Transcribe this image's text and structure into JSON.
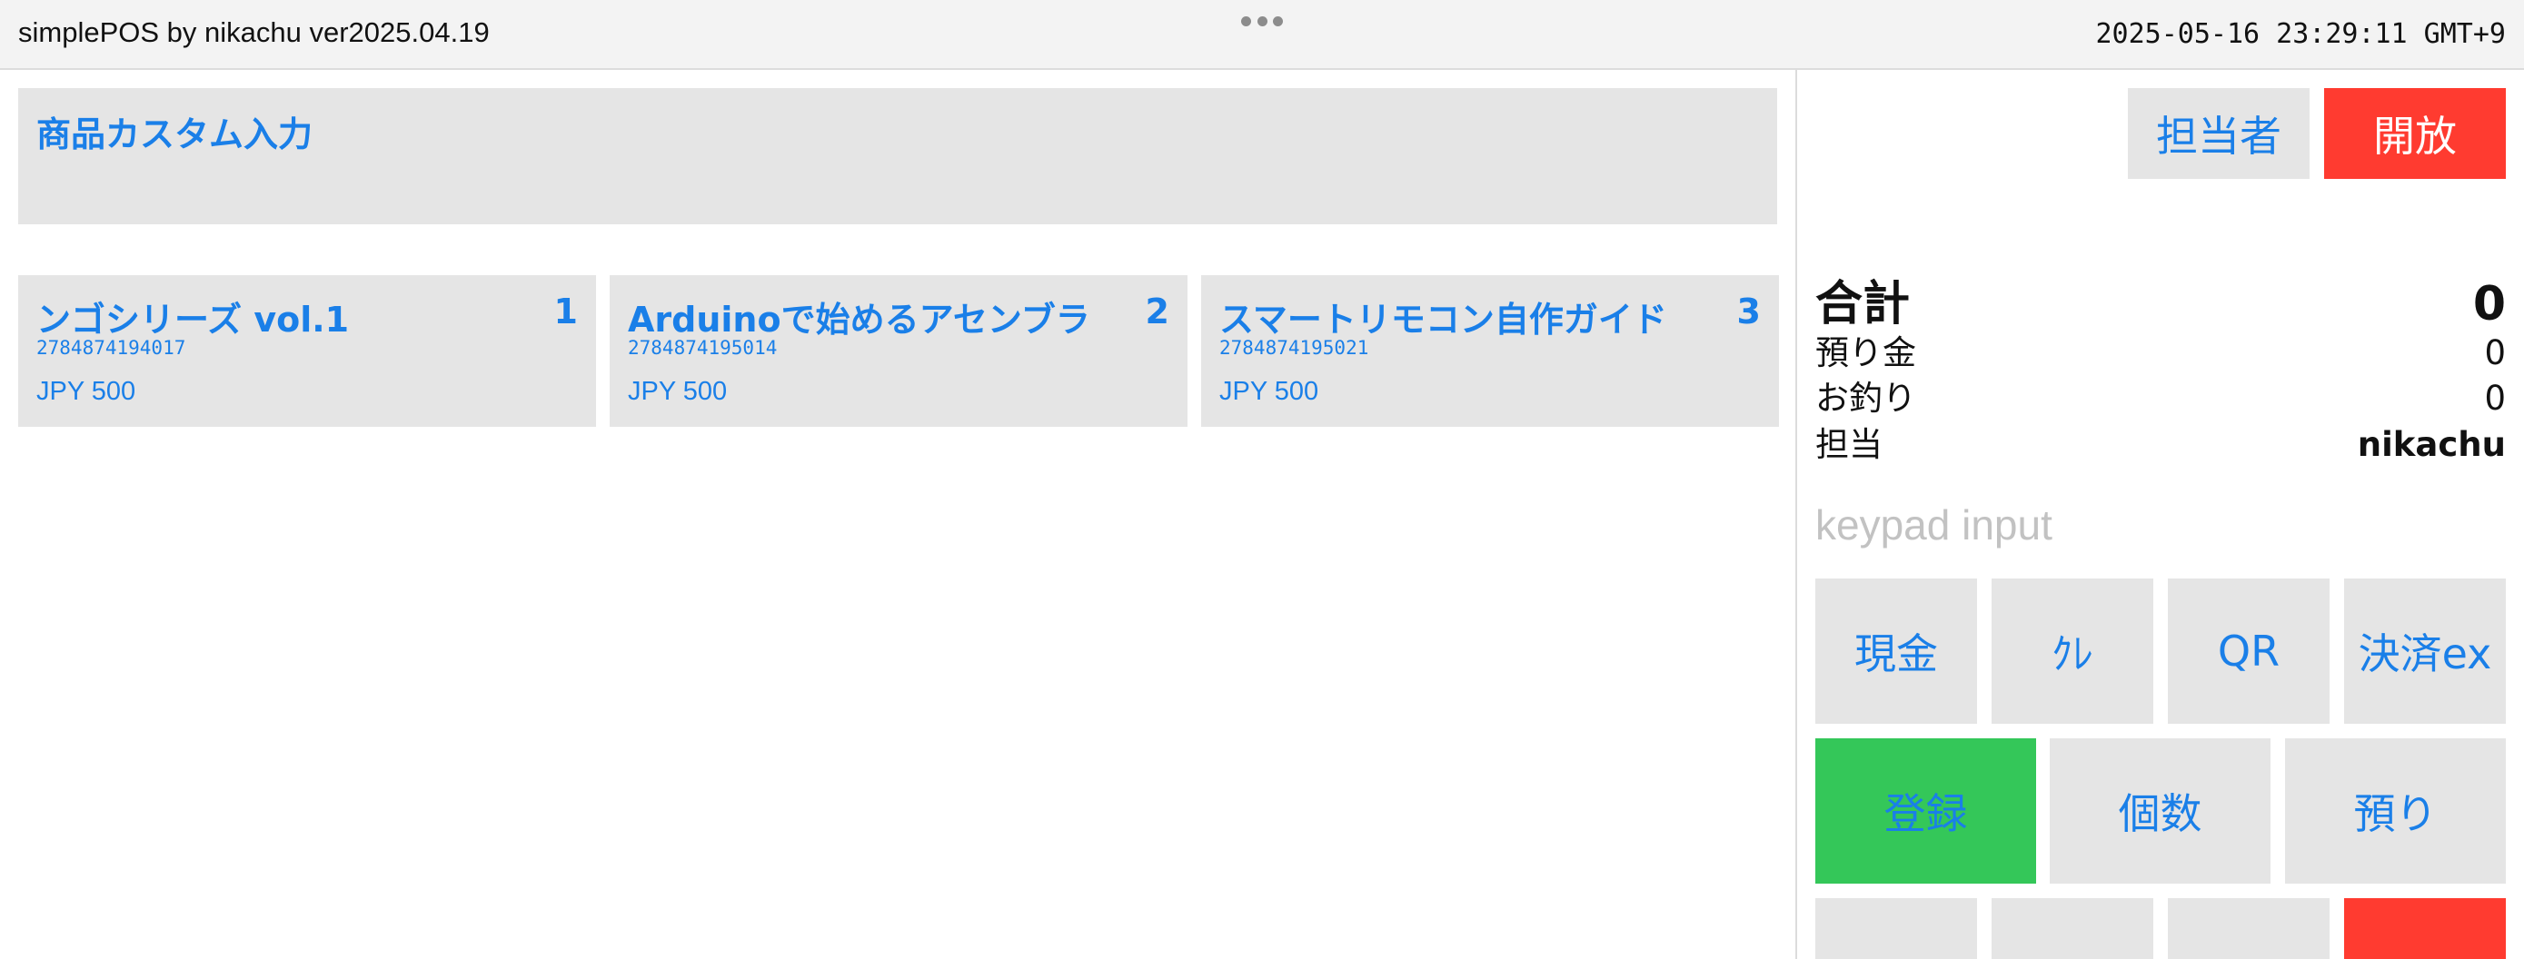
{
  "topbar": {
    "title": "simplePOS by nikachu ver2025.04.19",
    "clock": "2025-05-16 23:29:11 GMT+9"
  },
  "custom_input": {
    "label": "商品カスタム入力"
  },
  "products": [
    {
      "name": "ンゴシリーズ vol.1",
      "number": "1",
      "code": "2784874194017",
      "price": "JPY 500"
    },
    {
      "name": "Arduinoで始めるアセンブラ",
      "number": "2",
      "code": "2784874195014",
      "price": "JPY 500"
    },
    {
      "name": "スマートリモコン自作ガイド",
      "number": "3",
      "code": "2784874195021",
      "price": "JPY 500"
    }
  ],
  "header_buttons": {
    "staff": "担当者",
    "open": "開放"
  },
  "summary": {
    "total_label": "合計",
    "total_value": "0",
    "deposit_label": "預り金",
    "deposit_value": "0",
    "change_label": "お釣り",
    "change_value": "0",
    "staff_label": "担当",
    "staff_value": "nikachu"
  },
  "keypad": {
    "placeholder": "keypad input"
  },
  "payment_buttons": {
    "cash": "現金",
    "credit": "ｸﾚ",
    "qr": "QR",
    "ex": "決済ex"
  },
  "action_buttons": {
    "register": "登録",
    "quantity": "個数",
    "deposit": "預り"
  },
  "colors": {
    "accent": "#1a7fe8",
    "tile": "#e5e5e5",
    "danger": "#ff3b30",
    "success": "#34c759"
  }
}
